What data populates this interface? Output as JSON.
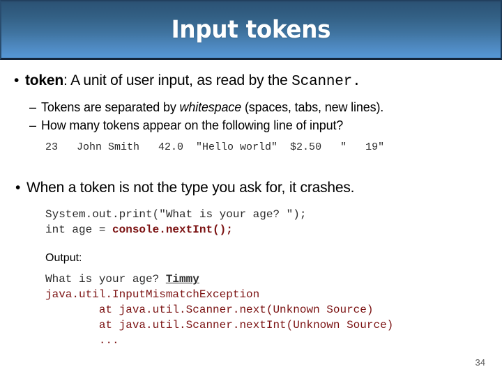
{
  "slide": {
    "title": "Input tokens",
    "page_number": "34",
    "accent_color_top": "#2d5578",
    "accent_color_bottom": "#5596d4",
    "code_highlight_color": "#7b1212"
  },
  "bullets": [
    {
      "marker": "•",
      "term": "token",
      "rest": ": A unit of user input, as read by the ",
      "mono_tail": "Scanner."
    },
    {
      "marker": "•",
      "text": "When a token is not the type you ask for, it crashes."
    }
  ],
  "sub_bullets": [
    {
      "marker": "–",
      "pre": "Tokens are separated by ",
      "italic": "whitespace",
      "post": " (spaces, tabs, new lines)."
    },
    {
      "marker": "–",
      "pre": "How many tokens appear on the following line of input?",
      "italic": "",
      "post": ""
    }
  ],
  "sample_input": {
    "line": "23   John Smith   42.0  \"Hello world\"  $2.50   \"   19\""
  },
  "code_block": {
    "line1": "System.out.print(\"What is your age? \");",
    "line2_plain": "int age = ",
    "line2_highlight": "console.nextInt();"
  },
  "output_block": {
    "label": "Output:",
    "line1_pre": "What is your age? ",
    "line1_input": "Timmy",
    "line2": "java.util.InputMismatchException",
    "line3": "        at java.util.Scanner.next(Unknown Source)",
    "line4": "        at java.util.Scanner.nextInt(Unknown Source)",
    "line5": "        ..."
  }
}
